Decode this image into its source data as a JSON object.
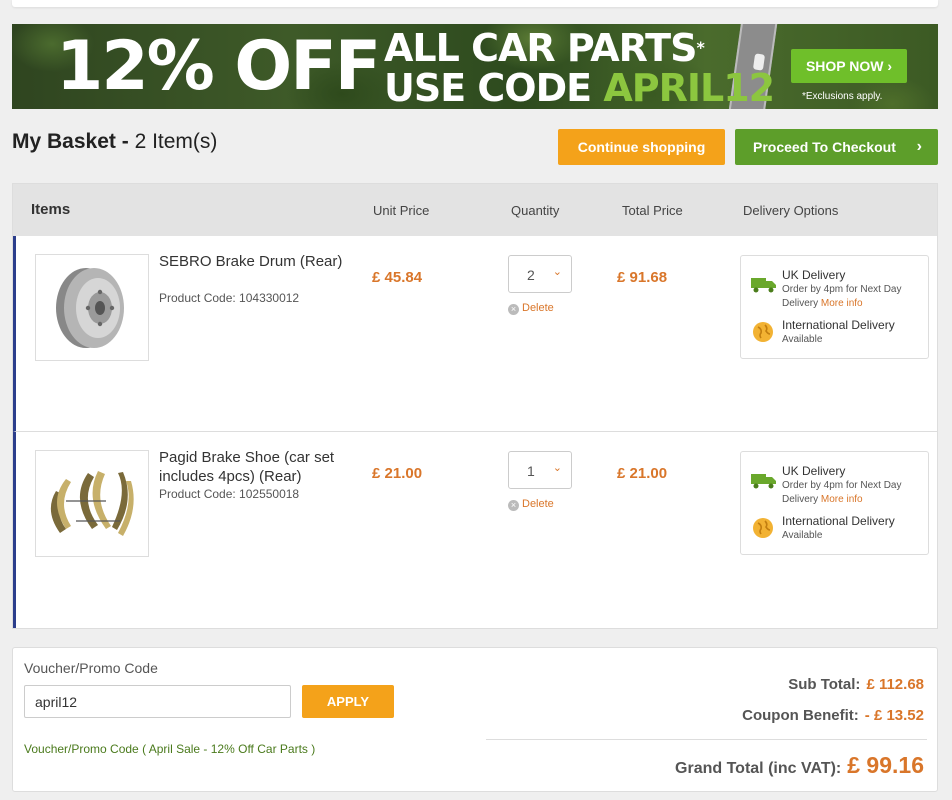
{
  "banner": {
    "big_text": "12% OFF",
    "line1": "ALL CAR PARTS",
    "line1_mark": "*",
    "line2_prefix": "USE CODE",
    "code": "APRIL12",
    "shop_now": "SHOP NOW",
    "shop_now_chevron": "›",
    "exclusions": "*Exclusions apply."
  },
  "header": {
    "title": "My Basket -",
    "count": "2 Item(s)",
    "continue_label": "Continue shopping",
    "checkout_label": "Proceed To Checkout",
    "checkout_chevron": "›"
  },
  "table": {
    "columns": [
      "Items",
      "Unit Price",
      "Quantity",
      "Total Price",
      "Delivery Options"
    ],
    "rows": [
      {
        "name": "SEBRO Brake Drum (Rear)",
        "code": "Product Code: 104330012",
        "unit_price": "£ 45.84",
        "quantity": "2",
        "total_price": "£ 91.68",
        "delete_label": "Delete",
        "image_icon": "brake-drum-icon"
      },
      {
        "name": "Pagid Brake Shoe (car set includes 4pcs) (Rear)",
        "code": "Product Code: 102550018",
        "unit_price": "£ 21.00",
        "quantity": "1",
        "total_price": "£ 21.00",
        "delete_label": "Delete",
        "image_icon": "brake-shoe-icon"
      }
    ],
    "delivery": {
      "uk_title": "UK Delivery",
      "uk_sub": "Order by 4pm for Next Day Delivery",
      "more_info": "More info",
      "intl_title": "International Delivery",
      "intl_sub": "Available"
    }
  },
  "promo": {
    "label": "Voucher/Promo Code",
    "value": "april12",
    "apply_label": "APPLY",
    "note": "Voucher/Promo Code ( April Sale - 12% Off Car Parts )"
  },
  "totals": {
    "sub_label": "Sub Total:",
    "sub_value": "£ 112.68",
    "coupon_label": "Coupon Benefit:",
    "coupon_value": "- £ 13.52",
    "grand_label": "Grand Total (inc VAT):",
    "grand_value": "£ 99.16"
  },
  "colors": {
    "orange": "#f4a21a",
    "green": "#5d9e2a",
    "price": "#d9762a",
    "row_accent": "#2c3e8c"
  }
}
